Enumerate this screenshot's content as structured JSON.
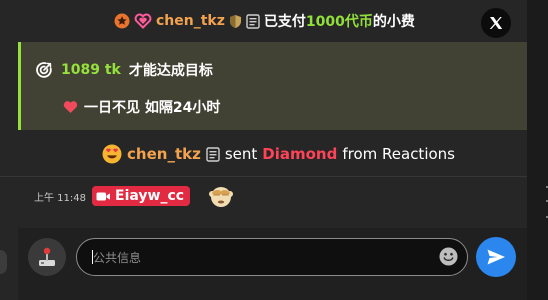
{
  "gift_banner": {
    "username": "chen_tkz",
    "text_before": "已支付",
    "amount": "1000代币",
    "text_after": "的小费"
  },
  "goal": {
    "amount": "1089 tk",
    "text": "才能达成目标",
    "description": "一日不见 如隔24小时"
  },
  "gift_event": {
    "username": "chen_tkz",
    "sent_label": "sent",
    "gift_name": "Diamond",
    "source_label": "from Reactions"
  },
  "message": {
    "time": "上午 11:48",
    "sender": "Eiayw_cc"
  },
  "input": {
    "placeholder": "公共信息"
  },
  "colors": {
    "accent_green": "#95e03c",
    "username_orange": "#f3a24e",
    "diamond_red": "#ff4458",
    "send_blue": "#2b87ee",
    "live_badge_red": "#e22b42"
  },
  "icons": [
    "star-badge-icon",
    "heart-gem-icon",
    "shield-icon",
    "note-icon",
    "x-logo-icon",
    "goal-target-icon",
    "heart-icon",
    "heart-eyes-emoji",
    "camera-icon",
    "see-no-evil-emoji",
    "joystick-icon",
    "smiley-icon",
    "send-icon"
  ]
}
